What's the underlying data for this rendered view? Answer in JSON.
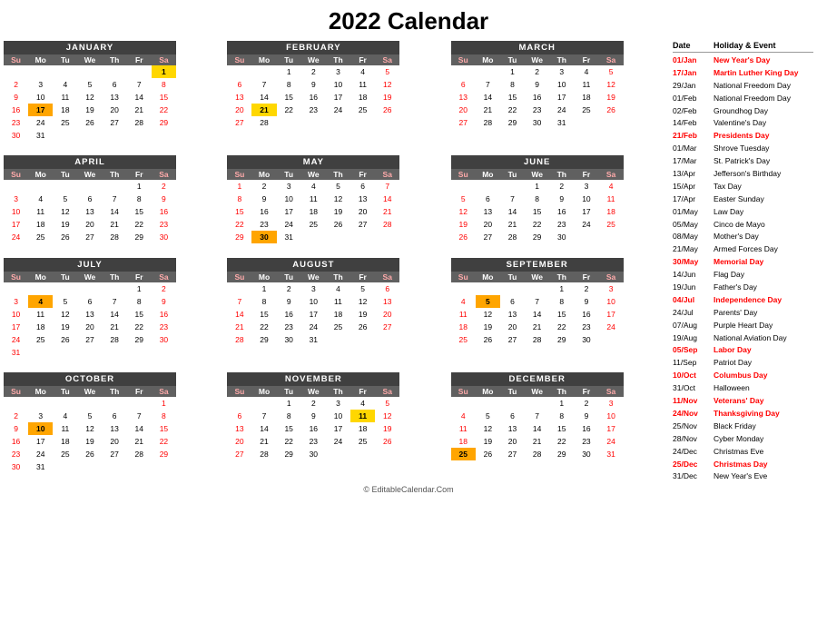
{
  "title": "2022 Calendar",
  "months": [
    {
      "name": "JANUARY",
      "weeks": [
        [
          "",
          "",
          "",
          "",
          "",
          "",
          "1"
        ],
        [
          "2",
          "3",
          "4",
          "5",
          "6",
          "7",
          "8"
        ],
        [
          "9",
          "10",
          "11",
          "12",
          "13",
          "14",
          "15"
        ],
        [
          "16",
          "17",
          "18",
          "19",
          "20",
          "21",
          "22"
        ],
        [
          "23",
          "24",
          "25",
          "26",
          "27",
          "28",
          "29"
        ],
        [
          "30",
          "31",
          "",
          "",
          "",
          "",
          ""
        ]
      ],
      "highlights": {
        "1": "yellow",
        "17": "orange"
      },
      "red_sa_su": {
        "1": true,
        "8": true,
        "15": true,
        "22": true,
        "29": true,
        "2": true,
        "9": true,
        "16": true,
        "23": true,
        "30": true
      }
    },
    {
      "name": "FEBRUARY",
      "weeks": [
        [
          "",
          "",
          "1",
          "2",
          "3",
          "4",
          "5"
        ],
        [
          "6",
          "7",
          "8",
          "9",
          "10",
          "11",
          "12"
        ],
        [
          "13",
          "14",
          "15",
          "16",
          "17",
          "18",
          "19"
        ],
        [
          "20",
          "21",
          "22",
          "23",
          "24",
          "25",
          "26"
        ],
        [
          "27",
          "28",
          "",
          "",
          "",
          "",
          ""
        ]
      ],
      "highlights": {
        "21": "yellow"
      },
      "red_sa_su": {
        "5": true,
        "12": true,
        "19": true,
        "26": true,
        "6": true,
        "13": true,
        "20": true,
        "27": true
      }
    },
    {
      "name": "MARCH",
      "weeks": [
        [
          "",
          "",
          "1",
          "2",
          "3",
          "4",
          "5"
        ],
        [
          "6",
          "7",
          "8",
          "9",
          "10",
          "11",
          "12"
        ],
        [
          "13",
          "14",
          "15",
          "16",
          "17",
          "18",
          "19"
        ],
        [
          "20",
          "21",
          "22",
          "23",
          "24",
          "25",
          "26"
        ],
        [
          "27",
          "28",
          "29",
          "30",
          "31",
          "",
          ""
        ]
      ],
      "highlights": {},
      "red_sa_su": {
        "5": true,
        "12": true,
        "19": true,
        "26": true,
        "6": true,
        "13": true,
        "20": true,
        "27": true
      }
    },
    {
      "name": "APRIL",
      "weeks": [
        [
          "",
          "",
          "",
          "",
          "",
          "1",
          "2"
        ],
        [
          "3",
          "4",
          "5",
          "6",
          "7",
          "8",
          "9"
        ],
        [
          "10",
          "11",
          "12",
          "13",
          "14",
          "15",
          "16"
        ],
        [
          "17",
          "18",
          "19",
          "20",
          "21",
          "22",
          "23"
        ],
        [
          "24",
          "25",
          "26",
          "27",
          "28",
          "29",
          "30"
        ]
      ],
      "highlights": {},
      "red_sa_su": {
        "1": true,
        "2": true,
        "9": true,
        "16": true,
        "23": true,
        "30": true,
        "3": true,
        "10": true,
        "17": true,
        "24": true
      }
    },
    {
      "name": "MAY",
      "weeks": [
        [
          "1",
          "2",
          "3",
          "4",
          "5",
          "6",
          "7"
        ],
        [
          "8",
          "9",
          "10",
          "11",
          "12",
          "13",
          "14"
        ],
        [
          "15",
          "16",
          "17",
          "18",
          "19",
          "20",
          "21"
        ],
        [
          "22",
          "23",
          "24",
          "25",
          "26",
          "27",
          "28"
        ],
        [
          "29",
          "30",
          "31",
          "",
          "",
          "",
          ""
        ]
      ],
      "highlights": {
        "30": "orange"
      },
      "red_sa_su": {
        "1": true,
        "7": true,
        "8": true,
        "14": true,
        "15": true,
        "21": true,
        "22": true,
        "28": true,
        "29": true
      }
    },
    {
      "name": "JUNE",
      "weeks": [
        [
          "",
          "",
          "",
          "1",
          "2",
          "3",
          "4"
        ],
        [
          "5",
          "6",
          "7",
          "8",
          "9",
          "10",
          "11"
        ],
        [
          "12",
          "13",
          "14",
          "15",
          "16",
          "17",
          "18"
        ],
        [
          "19",
          "20",
          "21",
          "22",
          "23",
          "24",
          "25"
        ],
        [
          "26",
          "27",
          "28",
          "29",
          "30",
          "",
          ""
        ]
      ],
      "highlights": {},
      "red_sa_su": {
        "4": true,
        "5": true,
        "11": true,
        "12": true,
        "18": true,
        "19": true,
        "25": true,
        "26": true
      }
    },
    {
      "name": "JULY",
      "weeks": [
        [
          "",
          "",
          "",
          "",
          "",
          "1",
          "2"
        ],
        [
          "3",
          "4",
          "5",
          "6",
          "7",
          "8",
          "9"
        ],
        [
          "10",
          "11",
          "12",
          "13",
          "14",
          "15",
          "16"
        ],
        [
          "17",
          "18",
          "19",
          "20",
          "21",
          "22",
          "23"
        ],
        [
          "24",
          "25",
          "26",
          "27",
          "28",
          "29",
          "30"
        ],
        [
          "31",
          "",
          "",
          "",
          "",
          "",
          ""
        ]
      ],
      "highlights": {
        "4": "orange"
      },
      "red_sa_su": {
        "1": true,
        "2": true,
        "3": true,
        "9": true,
        "10": true,
        "16": true,
        "17": true,
        "23": true,
        "24": true,
        "30": true,
        "31": true
      }
    },
    {
      "name": "AUGUST",
      "weeks": [
        [
          "",
          "1",
          "2",
          "3",
          "4",
          "5",
          "6"
        ],
        [
          "7",
          "8",
          "9",
          "10",
          "11",
          "12",
          "13"
        ],
        [
          "14",
          "15",
          "16",
          "17",
          "18",
          "19",
          "20"
        ],
        [
          "21",
          "22",
          "23",
          "24",
          "25",
          "26",
          "27"
        ],
        [
          "28",
          "29",
          "30",
          "31",
          "",
          "",
          ""
        ]
      ],
      "highlights": {},
      "red_sa_su": {
        "6": true,
        "7": true,
        "13": true,
        "14": true,
        "20": true,
        "21": true,
        "27": true,
        "28": true
      }
    },
    {
      "name": "SEPTEMBER",
      "weeks": [
        [
          "",
          "",
          "",
          "",
          "1",
          "2",
          "3"
        ],
        [
          "4",
          "5",
          "6",
          "7",
          "8",
          "9",
          "10"
        ],
        [
          "11",
          "12",
          "13",
          "14",
          "15",
          "16",
          "17"
        ],
        [
          "18",
          "19",
          "20",
          "21",
          "22",
          "23",
          "24"
        ],
        [
          "25",
          "26",
          "27",
          "28",
          "29",
          "30",
          ""
        ]
      ],
      "highlights": {
        "5": "orange"
      },
      "red_sa_su": {
        "3": true,
        "4": true,
        "10": true,
        "11": true,
        "17": true,
        "18": true,
        "24": true,
        "25": true
      }
    },
    {
      "name": "OCTOBER",
      "weeks": [
        [
          "",
          "",
          "",
          "",
          "",
          "",
          "1"
        ],
        [
          "2",
          "3",
          "4",
          "5",
          "6",
          "7",
          "8"
        ],
        [
          "9",
          "10",
          "11",
          "12",
          "13",
          "14",
          "15"
        ],
        [
          "16",
          "17",
          "18",
          "19",
          "20",
          "21",
          "22"
        ],
        [
          "23",
          "24",
          "25",
          "26",
          "27",
          "28",
          "29"
        ],
        [
          "30",
          "31",
          "",
          "",
          "",
          "",
          ""
        ]
      ],
      "highlights": {
        "10": "orange"
      },
      "red_sa_su": {
        "1": true,
        "2": true,
        "8": true,
        "9": true,
        "15": true,
        "16": true,
        "22": true,
        "23": true,
        "29": true,
        "30": true
      }
    },
    {
      "name": "NOVEMBER",
      "weeks": [
        [
          "",
          "",
          "1",
          "2",
          "3",
          "4",
          "5"
        ],
        [
          "6",
          "7",
          "8",
          "9",
          "10",
          "11",
          "12"
        ],
        [
          "13",
          "14",
          "15",
          "16",
          "17",
          "18",
          "19"
        ],
        [
          "20",
          "21",
          "22",
          "23",
          "24",
          "25",
          "26"
        ],
        [
          "27",
          "28",
          "29",
          "30",
          "",
          "",
          ""
        ]
      ],
      "highlights": {
        "11": "yellow"
      },
      "red_sa_su": {
        "5": true,
        "6": true,
        "12": true,
        "13": true,
        "19": true,
        "20": true,
        "26": true,
        "27": true
      }
    },
    {
      "name": "DECEMBER",
      "weeks": [
        [
          "",
          "",
          "",
          "",
          "1",
          "2",
          "3"
        ],
        [
          "4",
          "5",
          "6",
          "7",
          "8",
          "9",
          "10"
        ],
        [
          "11",
          "12",
          "13",
          "14",
          "15",
          "16",
          "17"
        ],
        [
          "18",
          "19",
          "20",
          "21",
          "22",
          "23",
          "24"
        ],
        [
          "25",
          "26",
          "27",
          "28",
          "29",
          "30",
          "31"
        ]
      ],
      "highlights": {
        "25": "orange"
      },
      "red_sa_su": {
        "3": true,
        "4": true,
        "10": true,
        "11": true,
        "17": true,
        "18": true,
        "24": true,
        "25": true,
        "31": true
      }
    }
  ],
  "sidebar": {
    "header": {
      "date": "Date",
      "event": "Holiday & Event"
    },
    "rows": [
      {
        "date": "01/Jan",
        "event": "New Year's Day",
        "date_red": true,
        "event_red": true
      },
      {
        "date": "17/Jan",
        "event": "Martin Luther King Day",
        "date_red": true,
        "event_red": true
      },
      {
        "date": "29/Jan",
        "event": "National Freedom Day",
        "date_red": false,
        "event_red": false
      },
      {
        "date": "01/Feb",
        "event": "National Freedom Day",
        "date_red": false,
        "event_red": false
      },
      {
        "date": "02/Feb",
        "event": "Groundhog Day",
        "date_red": false,
        "event_red": false
      },
      {
        "date": "14/Feb",
        "event": "Valentine's Day",
        "date_red": false,
        "event_red": false
      },
      {
        "date": "21/Feb",
        "event": "Presidents Day",
        "date_red": true,
        "event_red": true
      },
      {
        "date": "01/Mar",
        "event": "Shrove Tuesday",
        "date_red": false,
        "event_red": false
      },
      {
        "date": "17/Mar",
        "event": "St. Patrick's Day",
        "date_red": false,
        "event_red": false
      },
      {
        "date": "13/Apr",
        "event": "Jefferson's Birthday",
        "date_red": false,
        "event_red": false
      },
      {
        "date": "15/Apr",
        "event": "Tax Day",
        "date_red": false,
        "event_red": false
      },
      {
        "date": "17/Apr",
        "event": "Easter Sunday",
        "date_red": false,
        "event_red": false
      },
      {
        "date": "01/May",
        "event": "Law Day",
        "date_red": false,
        "event_red": false
      },
      {
        "date": "05/May",
        "event": "Cinco de Mayo",
        "date_red": false,
        "event_red": false
      },
      {
        "date": "08/May",
        "event": "Mother's Day",
        "date_red": false,
        "event_red": false
      },
      {
        "date": "21/May",
        "event": "Armed Forces Day",
        "date_red": false,
        "event_red": false
      },
      {
        "date": "30/May",
        "event": "Memorial Day",
        "date_red": true,
        "event_red": true
      },
      {
        "date": "14/Jun",
        "event": "Flag Day",
        "date_red": false,
        "event_red": false
      },
      {
        "date": "19/Jun",
        "event": "Father's Day",
        "date_red": false,
        "event_red": false
      },
      {
        "date": "04/Jul",
        "event": "Independence Day",
        "date_red": true,
        "event_red": true
      },
      {
        "date": "24/Jul",
        "event": "Parents' Day",
        "date_red": false,
        "event_red": false
      },
      {
        "date": "07/Aug",
        "event": "Purple Heart Day",
        "date_red": false,
        "event_red": false
      },
      {
        "date": "19/Aug",
        "event": "National Aviation Day",
        "date_red": false,
        "event_red": false
      },
      {
        "date": "05/Sep",
        "event": "Labor Day",
        "date_red": true,
        "event_red": true
      },
      {
        "date": "11/Sep",
        "event": "Patriot Day",
        "date_red": false,
        "event_red": false
      },
      {
        "date": "10/Oct",
        "event": "Columbus Day",
        "date_red": true,
        "event_red": true
      },
      {
        "date": "31/Oct",
        "event": "Halloween",
        "date_red": false,
        "event_red": false
      },
      {
        "date": "11/Nov",
        "event": "Veterans' Day",
        "date_red": true,
        "event_red": true
      },
      {
        "date": "24/Nov",
        "event": "Thanksgiving Day",
        "date_red": true,
        "event_red": true
      },
      {
        "date": "25/Nov",
        "event": "Black Friday",
        "date_red": false,
        "event_red": false
      },
      {
        "date": "28/Nov",
        "event": "Cyber Monday",
        "date_red": false,
        "event_red": false
      },
      {
        "date": "24/Dec",
        "event": "Christmas Eve",
        "date_red": false,
        "event_red": false
      },
      {
        "date": "25/Dec",
        "event": "Christmas Day",
        "date_red": true,
        "event_red": true
      },
      {
        "date": "31/Dec",
        "event": "New Year's Eve",
        "date_red": false,
        "event_red": false
      }
    ]
  },
  "footer": "© EditableCalendar.Com"
}
